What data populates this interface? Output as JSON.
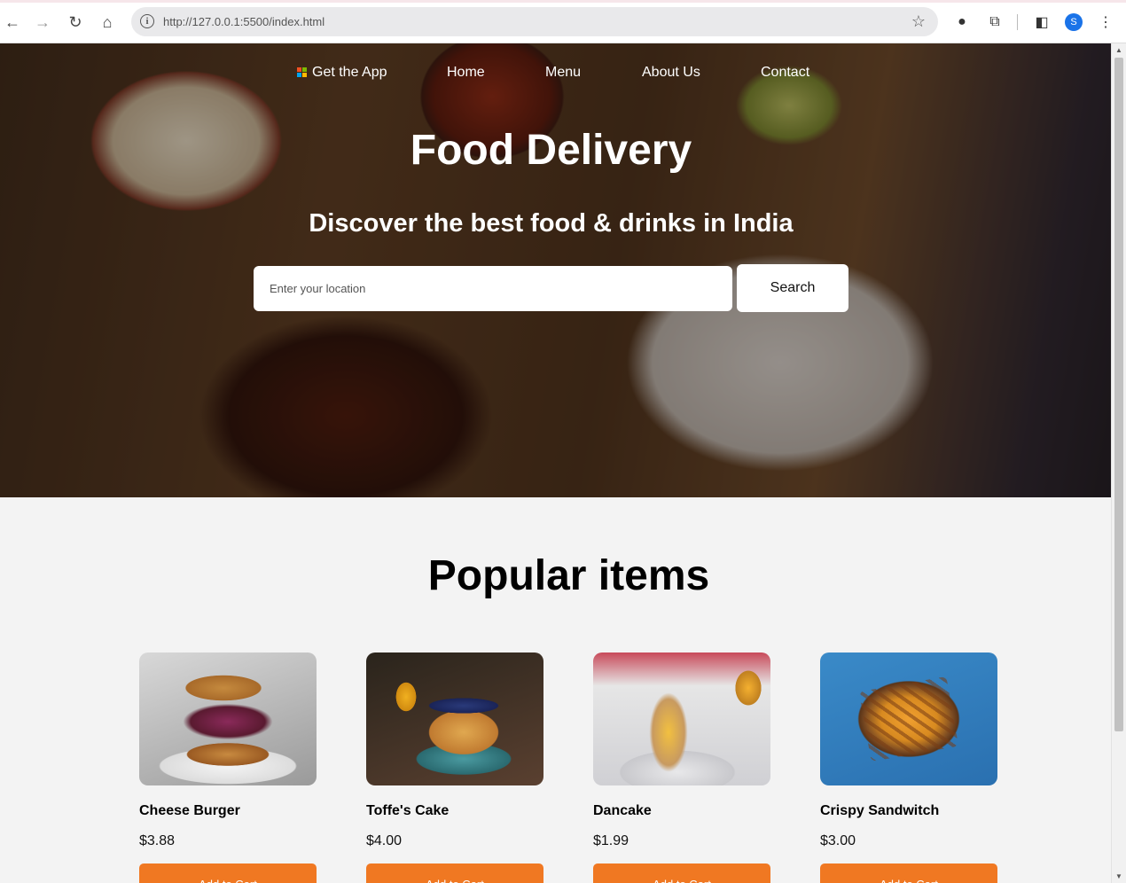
{
  "browser": {
    "url": "http://127.0.0.1:5500/index.html",
    "avatar_initial": "S"
  },
  "nav": {
    "items": [
      "Get the App",
      "Home",
      "Menu",
      "About Us",
      "Contact"
    ]
  },
  "hero": {
    "title": "Food Delivery",
    "subtitle": "Discover the best food & drinks in India",
    "search_placeholder": "Enter your location",
    "search_button": "Search"
  },
  "popular": {
    "title": "Popular items",
    "items": [
      {
        "name": "Cheese Burger",
        "price": "$3.88",
        "button": "Add to Cart"
      },
      {
        "name": "Toffe's Cake",
        "price": "$4.00",
        "button": "Add to Cart"
      },
      {
        "name": "Dancake",
        "price": "$1.99",
        "button": "Add to Cart"
      },
      {
        "name": "Crispy Sandwitch",
        "price": "$3.00",
        "button": "Add to Cart"
      }
    ]
  },
  "colors": {
    "accent": "#f07822",
    "page_bg": "#f3f3f3"
  }
}
